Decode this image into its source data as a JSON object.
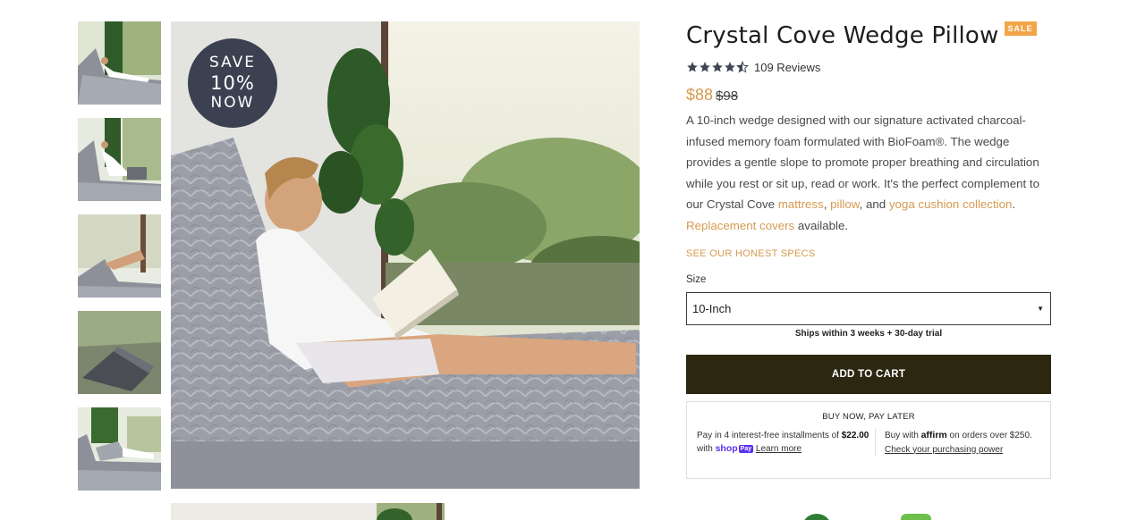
{
  "gallery": {
    "thumbnails": [
      {
        "alt": "thumbnail-1"
      },
      {
        "alt": "thumbnail-2"
      },
      {
        "alt": "thumbnail-3"
      },
      {
        "alt": "thumbnail-4"
      },
      {
        "alt": "thumbnail-5"
      }
    ],
    "badge": {
      "line1": "SAVE",
      "line2": "10%",
      "line3": "NOW"
    }
  },
  "product": {
    "title": "Crystal Cove Wedge Pillow",
    "sale_badge": "SALE",
    "rating": 4.5,
    "reviews_label": "109 Reviews",
    "price": "$88",
    "compare_price": "$98",
    "description": {
      "intro": "A 10-inch wedge designed with our signature activated charcoal-infused memory foam formulated with BioFoam®. The wedge provides a gentle slope to promote proper breathing and circulation while you rest or sit up, read or work. It's the perfect complement to our Crystal Cove ",
      "link_mattress": "mattress",
      "sep1": ", ",
      "link_pillow": "pillow",
      "sep2": ", and ",
      "link_yoga": "yoga cushion collection",
      "sep3": ". ",
      "link_covers": "Replacement covers",
      "outro": " available."
    },
    "specs_link": "SEE OUR HONEST SPECS",
    "size_label": "Size",
    "size_selected": "10-Inch",
    "ships_note": "Ships within 3 weeks  + 30-day trial",
    "add_to_cart": "ADD TO CART"
  },
  "bnpl": {
    "title": "BUY NOW, PAY LATER",
    "shop_text1": "Pay in 4 interest-free installments of ",
    "shop_amount": "$22.00",
    "shop_text2": " with ",
    "shop_brand": "shop",
    "shop_pay": "Pay",
    "shop_learn": "Learn more",
    "affirm_text1": "Buy with ",
    "affirm_brand": "affirm",
    "affirm_text2": " on orders over $250.",
    "affirm_link": "Check your purchasing power"
  },
  "colors": {
    "accent": "#d59a4f",
    "sale": "#f2a649",
    "cart_button": "#2b2711",
    "badge": "#3b4150"
  }
}
